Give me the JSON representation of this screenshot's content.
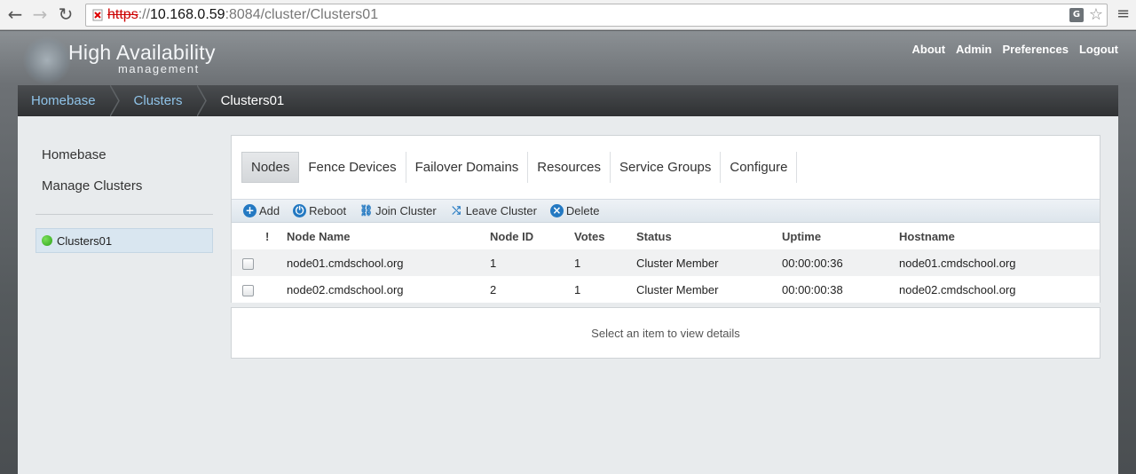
{
  "browser": {
    "url_protocol": "https",
    "url_sep": "://",
    "url_host": "10.168.0.59",
    "url_path": ":8084/cluster/Clusters01",
    "back_icon": "back-arrow-icon",
    "forward_icon": "forward-arrow-icon",
    "reload_icon": "reload-icon"
  },
  "app": {
    "title": "High Availability",
    "subtitle": "management"
  },
  "topnav": {
    "items": [
      "About",
      "Admin",
      "Preferences",
      "Logout"
    ]
  },
  "breadcrumb": {
    "items": [
      "Homebase",
      "Clusters",
      "Clusters01"
    ]
  },
  "sidebar": {
    "items": [
      "Homebase",
      "Manage Clusters"
    ],
    "cluster": "Clusters01",
    "cluster_status_color": "#2ea31a"
  },
  "tabs": [
    "Nodes",
    "Fence Devices",
    "Failover Domains",
    "Resources",
    "Service Groups",
    "Configure"
  ],
  "toolbar": {
    "add": "Add",
    "reboot": "Reboot",
    "join": "Join Cluster",
    "leave": "Leave Cluster",
    "delete": "Delete"
  },
  "table": {
    "headers": [
      "!",
      "Node Name",
      "Node ID",
      "Votes",
      "Status",
      "Uptime",
      "Hostname"
    ],
    "rows": [
      [
        "node01.cmdschool.org",
        "1",
        "1",
        "Cluster Member",
        "00:00:00:36",
        "node01.cmdschool.org"
      ],
      [
        "node02.cmdschool.org",
        "2",
        "1",
        "Cluster Member",
        "00:00:00:38",
        "node02.cmdschool.org"
      ]
    ]
  },
  "details": {
    "placeholder": "Select an item to view details"
  }
}
